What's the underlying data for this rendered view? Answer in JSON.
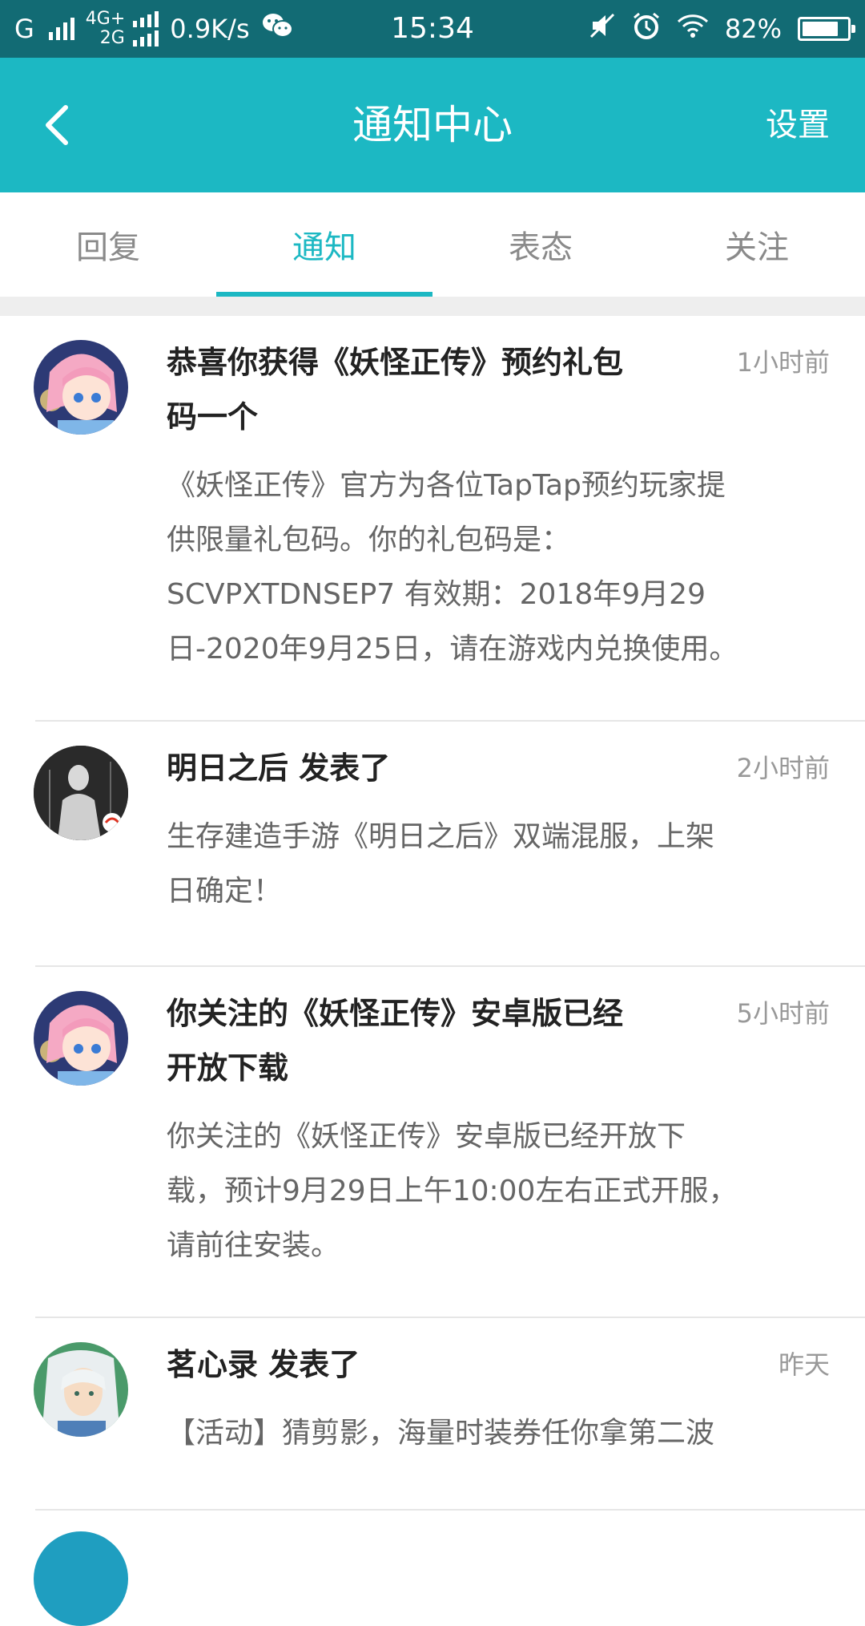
{
  "status_bar": {
    "carrier1": "G",
    "carrier2_top": "4G+",
    "carrier2_bottom": "2G",
    "speed": "0.9K/s",
    "time": "15:34",
    "battery": "82%",
    "battery_level": 0.82
  },
  "header": {
    "title": "通知中心",
    "settings_label": "设置"
  },
  "tabs": [
    {
      "label": "回复"
    },
    {
      "label": "通知"
    },
    {
      "label": "表态"
    },
    {
      "label": "关注"
    }
  ],
  "active_tab": "通知",
  "notifications": [
    {
      "title_line1": "恭喜你获得《妖怪正传》预约礼包",
      "title_line2": "码一个",
      "time": "1小时前",
      "body_lines": [
        "《妖怪正传》官方为各位TapTap预约玩家提",
        "供限量礼包码。你的礼包码是：",
        "SCVPXTDNSEP7 有效期：2018年9月29",
        "日-2020年9月25日，请在游戏内兑换使用。"
      ]
    },
    {
      "title_line1": "明日之后 发表了",
      "time": "2小时前",
      "body_lines": [
        "生存建造手游《明日之后》双端混服，上架",
        "日确定！"
      ]
    },
    {
      "title_line1": "你关注的《妖怪正传》安卓版已经",
      "title_line2": "开放下载",
      "time": "5小时前",
      "body_lines": [
        "你关注的《妖怪正传》安卓版已经开放下",
        "载，预计9月29日上午10:00左右正式开服，",
        "请前往安装。"
      ]
    },
    {
      "title_line1": "茗心录 发表了",
      "time": "昨天",
      "body_lines": [
        "【活动】猜剪影，海量时装券任你拿第二波"
      ]
    }
  ],
  "colors": {
    "status_bar": "#126b74",
    "header": "#1cb8c3",
    "accent": "#1cb8c3",
    "tab_inactive": "#8a8a8a",
    "title_text": "#222222",
    "body_text": "#666666",
    "time_text": "#999999"
  }
}
